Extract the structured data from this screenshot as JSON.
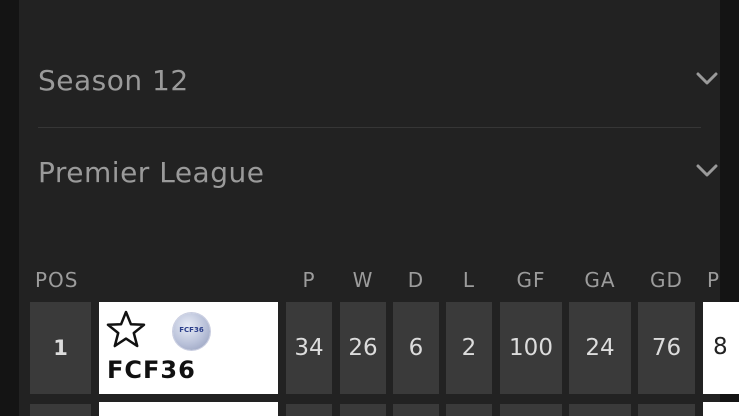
{
  "filters": {
    "season": "Season 12",
    "league": "Premier League"
  },
  "table": {
    "columns": [
      "POS",
      "P",
      "W",
      "D",
      "L",
      "GF",
      "GA",
      "GD",
      "P"
    ],
    "rows": [
      {
        "pos": "1",
        "team": "FCF36",
        "badge_text": "FCF36",
        "p": "34",
        "w": "26",
        "d": "6",
        "l": "2",
        "gf": "100",
        "ga": "24",
        "gd": "76",
        "pts_partial": "8"
      }
    ]
  },
  "colors": {
    "background": "#222222",
    "cell": "#3a3a3a",
    "label": "#9a9a9a",
    "team_card": "#ffffff"
  },
  "icons": [
    "chevron-down-icon",
    "star-icon",
    "club-badge"
  ]
}
